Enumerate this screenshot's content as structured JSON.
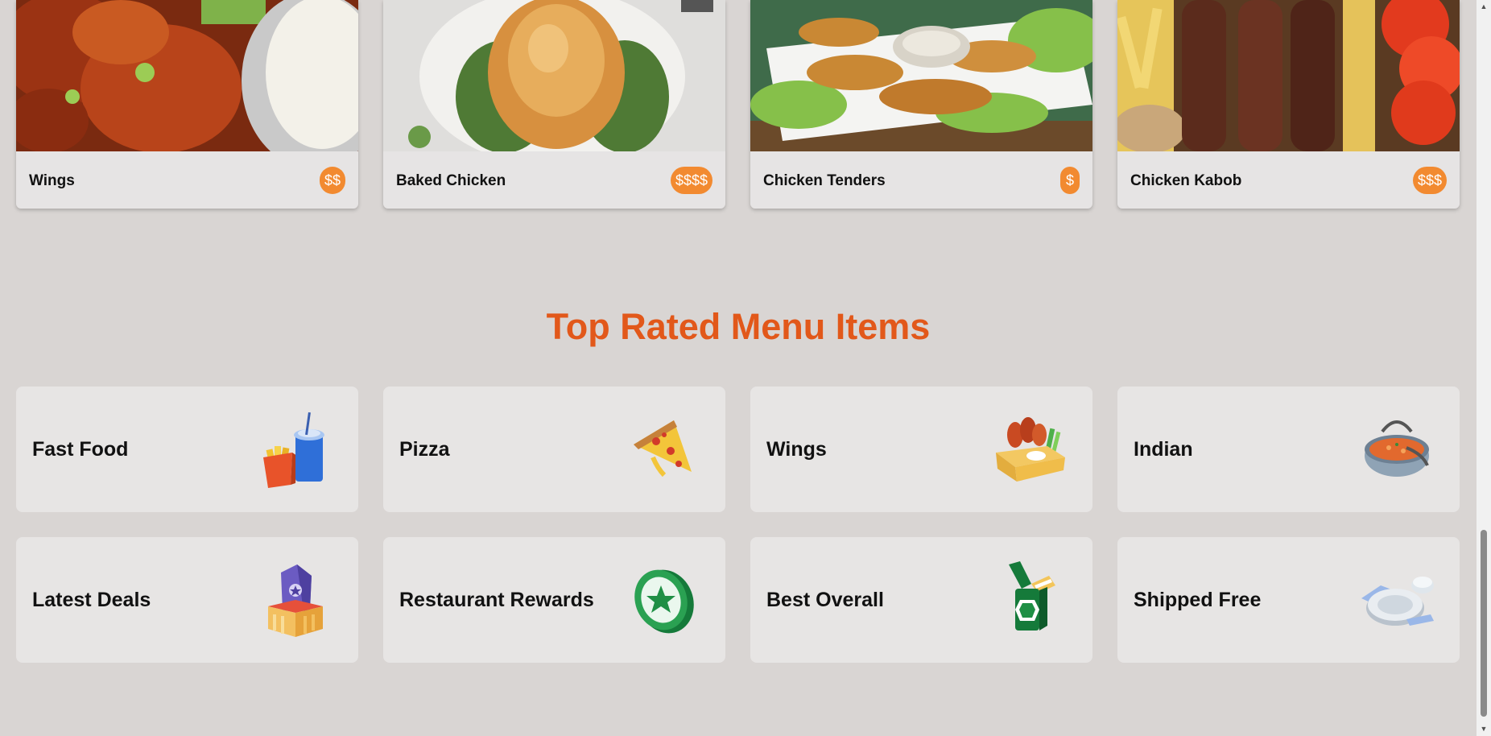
{
  "food_cards": [
    {
      "name": "Wings",
      "price": "$$"
    },
    {
      "name": "Baked Chicken",
      "price": "$$$$"
    },
    {
      "name": "Chicken Tenders",
      "price": "$"
    },
    {
      "name": "Chicken Kabob",
      "price": "$$$"
    }
  ],
  "top_rated": {
    "title": "Top Rated Menu Items",
    "categories": [
      {
        "label": "Fast Food",
        "icon": "fast-food-icon"
      },
      {
        "label": "Pizza",
        "icon": "pizza-icon"
      },
      {
        "label": "Wings",
        "icon": "wings-icon"
      },
      {
        "label": "Indian",
        "icon": "indian-icon"
      },
      {
        "label": "Latest Deals",
        "icon": "deals-icon"
      },
      {
        "label": "Restaurant Rewards",
        "icon": "rewards-icon"
      },
      {
        "label": "Best Overall",
        "icon": "best-overall-icon"
      },
      {
        "label": "Shipped Free",
        "icon": "shipped-free-icon"
      }
    ]
  },
  "colors": {
    "page_background": "#d9d5d3",
    "accent_title": "#e2581a",
    "price_badge": "#f28a30",
    "card_background": "#e7e5e4"
  }
}
